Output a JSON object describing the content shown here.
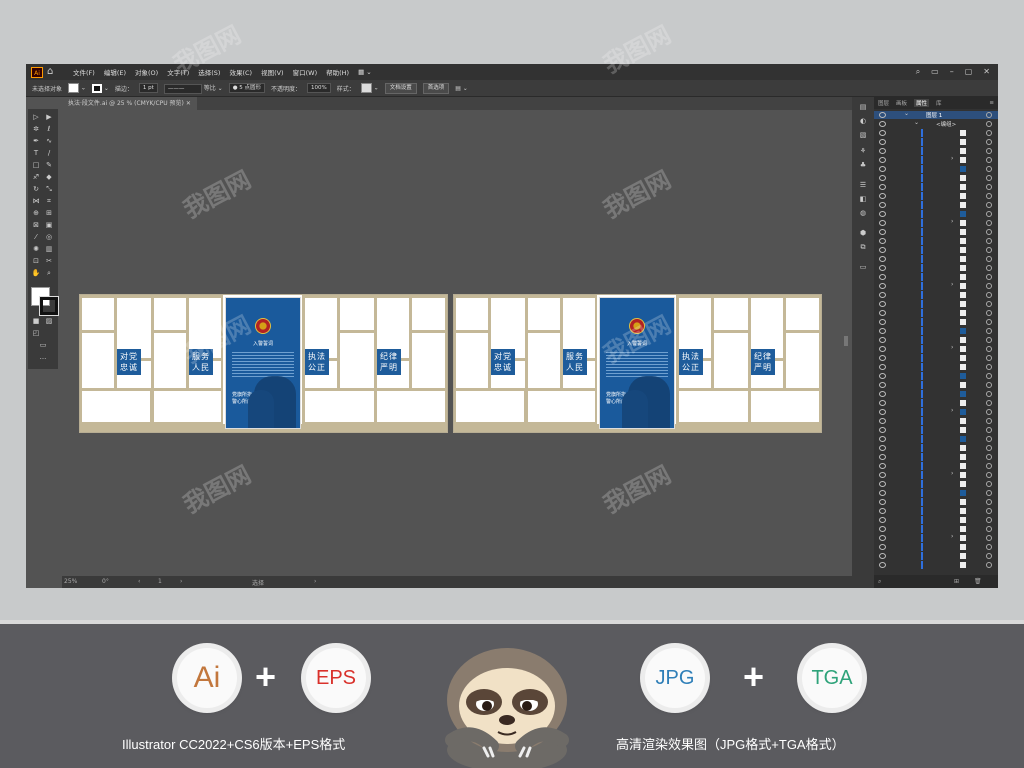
{
  "menubar": {
    "logo": "Ai",
    "items": [
      "文件(F)",
      "编辑(E)",
      "对象(O)",
      "文字(T)",
      "选择(S)",
      "效果(C)",
      "视图(V)",
      "窗口(W)",
      "帮助(H)"
    ]
  },
  "controlbar": {
    "selection": "未选择对象",
    "stroke_label": "描边：",
    "stroke_value": "1 pt",
    "line_style": "等比",
    "brush": "5 点圆形",
    "opacity_label": "不透明度：",
    "opacity_value": "100%",
    "style_label": "样式：",
    "doc_setup": "文档设置",
    "prefs": "首选项"
  },
  "document_tab": {
    "title": "执法·段文件.ai @ 25 % (CMYK/CPU 预览)"
  },
  "statusbar": {
    "zoom": "25%",
    "angle": "0°",
    "artboard": "1",
    "tool": "选择"
  },
  "layers": {
    "tabs": [
      "图层",
      "画板",
      "属性",
      "库"
    ],
    "layer_name": "图层 1",
    "group_name": "<编组>"
  },
  "artwork": {
    "panels": [
      {
        "labels": [
          "对党\n忠诚",
          "服务\n人民",
          "执法\n公正",
          "纪律\n严明"
        ],
        "oath_title": "入警誓词",
        "oath_footer": "党旗所指\n警心所向"
      },
      {
        "labels": [
          "对党\n忠诚",
          "服务\n人民",
          "执法\n公正",
          "纪律\n严明"
        ],
        "oath_title": "入警誓词",
        "oath_footer": "党旗所指\n警心所向"
      }
    ]
  },
  "banner": {
    "badges": [
      {
        "text": "Ai",
        "color": "#c2773d"
      },
      {
        "text": "EPS",
        "color": "#d9312b"
      },
      {
        "text": "JPG",
        "color": "#2f7fb8"
      },
      {
        "text": "TGA",
        "color": "#2ea37a"
      }
    ],
    "plus": "+",
    "caption_left": "Illustrator CC2022+CS6版本+EPS格式",
    "caption_right": "高清渲染效果图（JPG格式+TGA格式）"
  }
}
